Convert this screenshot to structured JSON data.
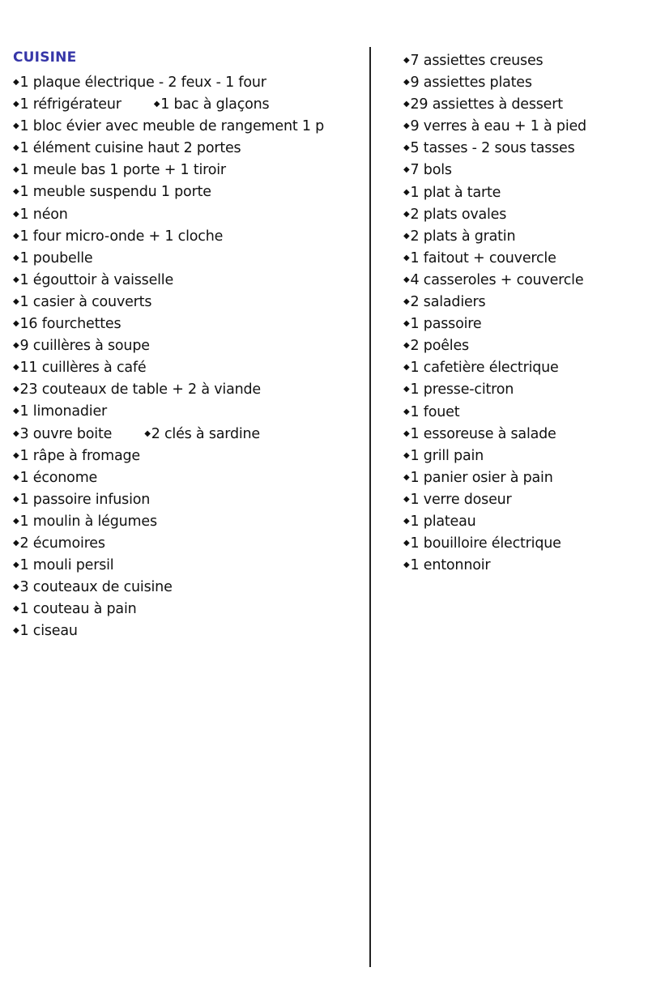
{
  "section_title": "CUISINE",
  "bullet_glyph": "◆",
  "left_column": [
    [
      "1 plaque électrique  -  2 feux  -  1 four"
    ],
    [
      "1 réfrigérateur",
      "1 bac à glaçons"
    ],
    [
      "1 bloc évier avec meuble de rangement 1 p"
    ],
    [
      "1 élément cuisine haut 2 portes"
    ],
    [
      "1 meule bas 1 porte + 1 tiroir"
    ],
    [
      "1 meuble suspendu 1 porte"
    ],
    [
      "1 néon"
    ],
    [
      "1 four micro-onde + 1 cloche"
    ],
    [
      "1 poubelle"
    ],
    [
      "1 égouttoir à vaisselle"
    ],
    [
      "1 casier à couverts"
    ],
    [
      "16 fourchettes"
    ],
    [
      "9 cuillères à soupe"
    ],
    [
      "11 cuillères à café"
    ],
    [
      "23 couteaux de table + 2 à viande"
    ],
    [
      "1 limonadier"
    ],
    [
      "3 ouvre boite",
      "2 clés à sardine"
    ],
    [
      "1 râpe à fromage"
    ],
    [
      "1 économe"
    ],
    [
      "1 passoire infusion"
    ],
    [
      "1 moulin à légumes"
    ],
    [
      "2 écumoires"
    ],
    [
      "1 mouli persil"
    ],
    [
      "3 couteaux de cuisine"
    ],
    [
      "1 couteau à pain"
    ],
    [
      "1 ciseau"
    ]
  ],
  "right_column": [
    "7 assiettes creuses",
    "9 assiettes plates",
    "29 assiettes à dessert",
    "9 verres à eau + 1 à pied",
    "5 tasses  -  2 sous tasses",
    "7 bols",
    "1 plat à tarte",
    "2 plats ovales",
    "2 plats à gratin",
    "1 faitout + couvercle",
    "4 casseroles + couvercle",
    "2 saladiers",
    "1 passoire",
    "2 poêles",
    "1 cafetière électrique",
    "1 presse-citron",
    "1 fouet",
    "1 essoreuse à salade",
    "1 grill pain",
    "1 panier osier à pain",
    "1 verre doseur",
    "1 plateau",
    "1 bouilloire électrique",
    "1 entonnoir"
  ]
}
